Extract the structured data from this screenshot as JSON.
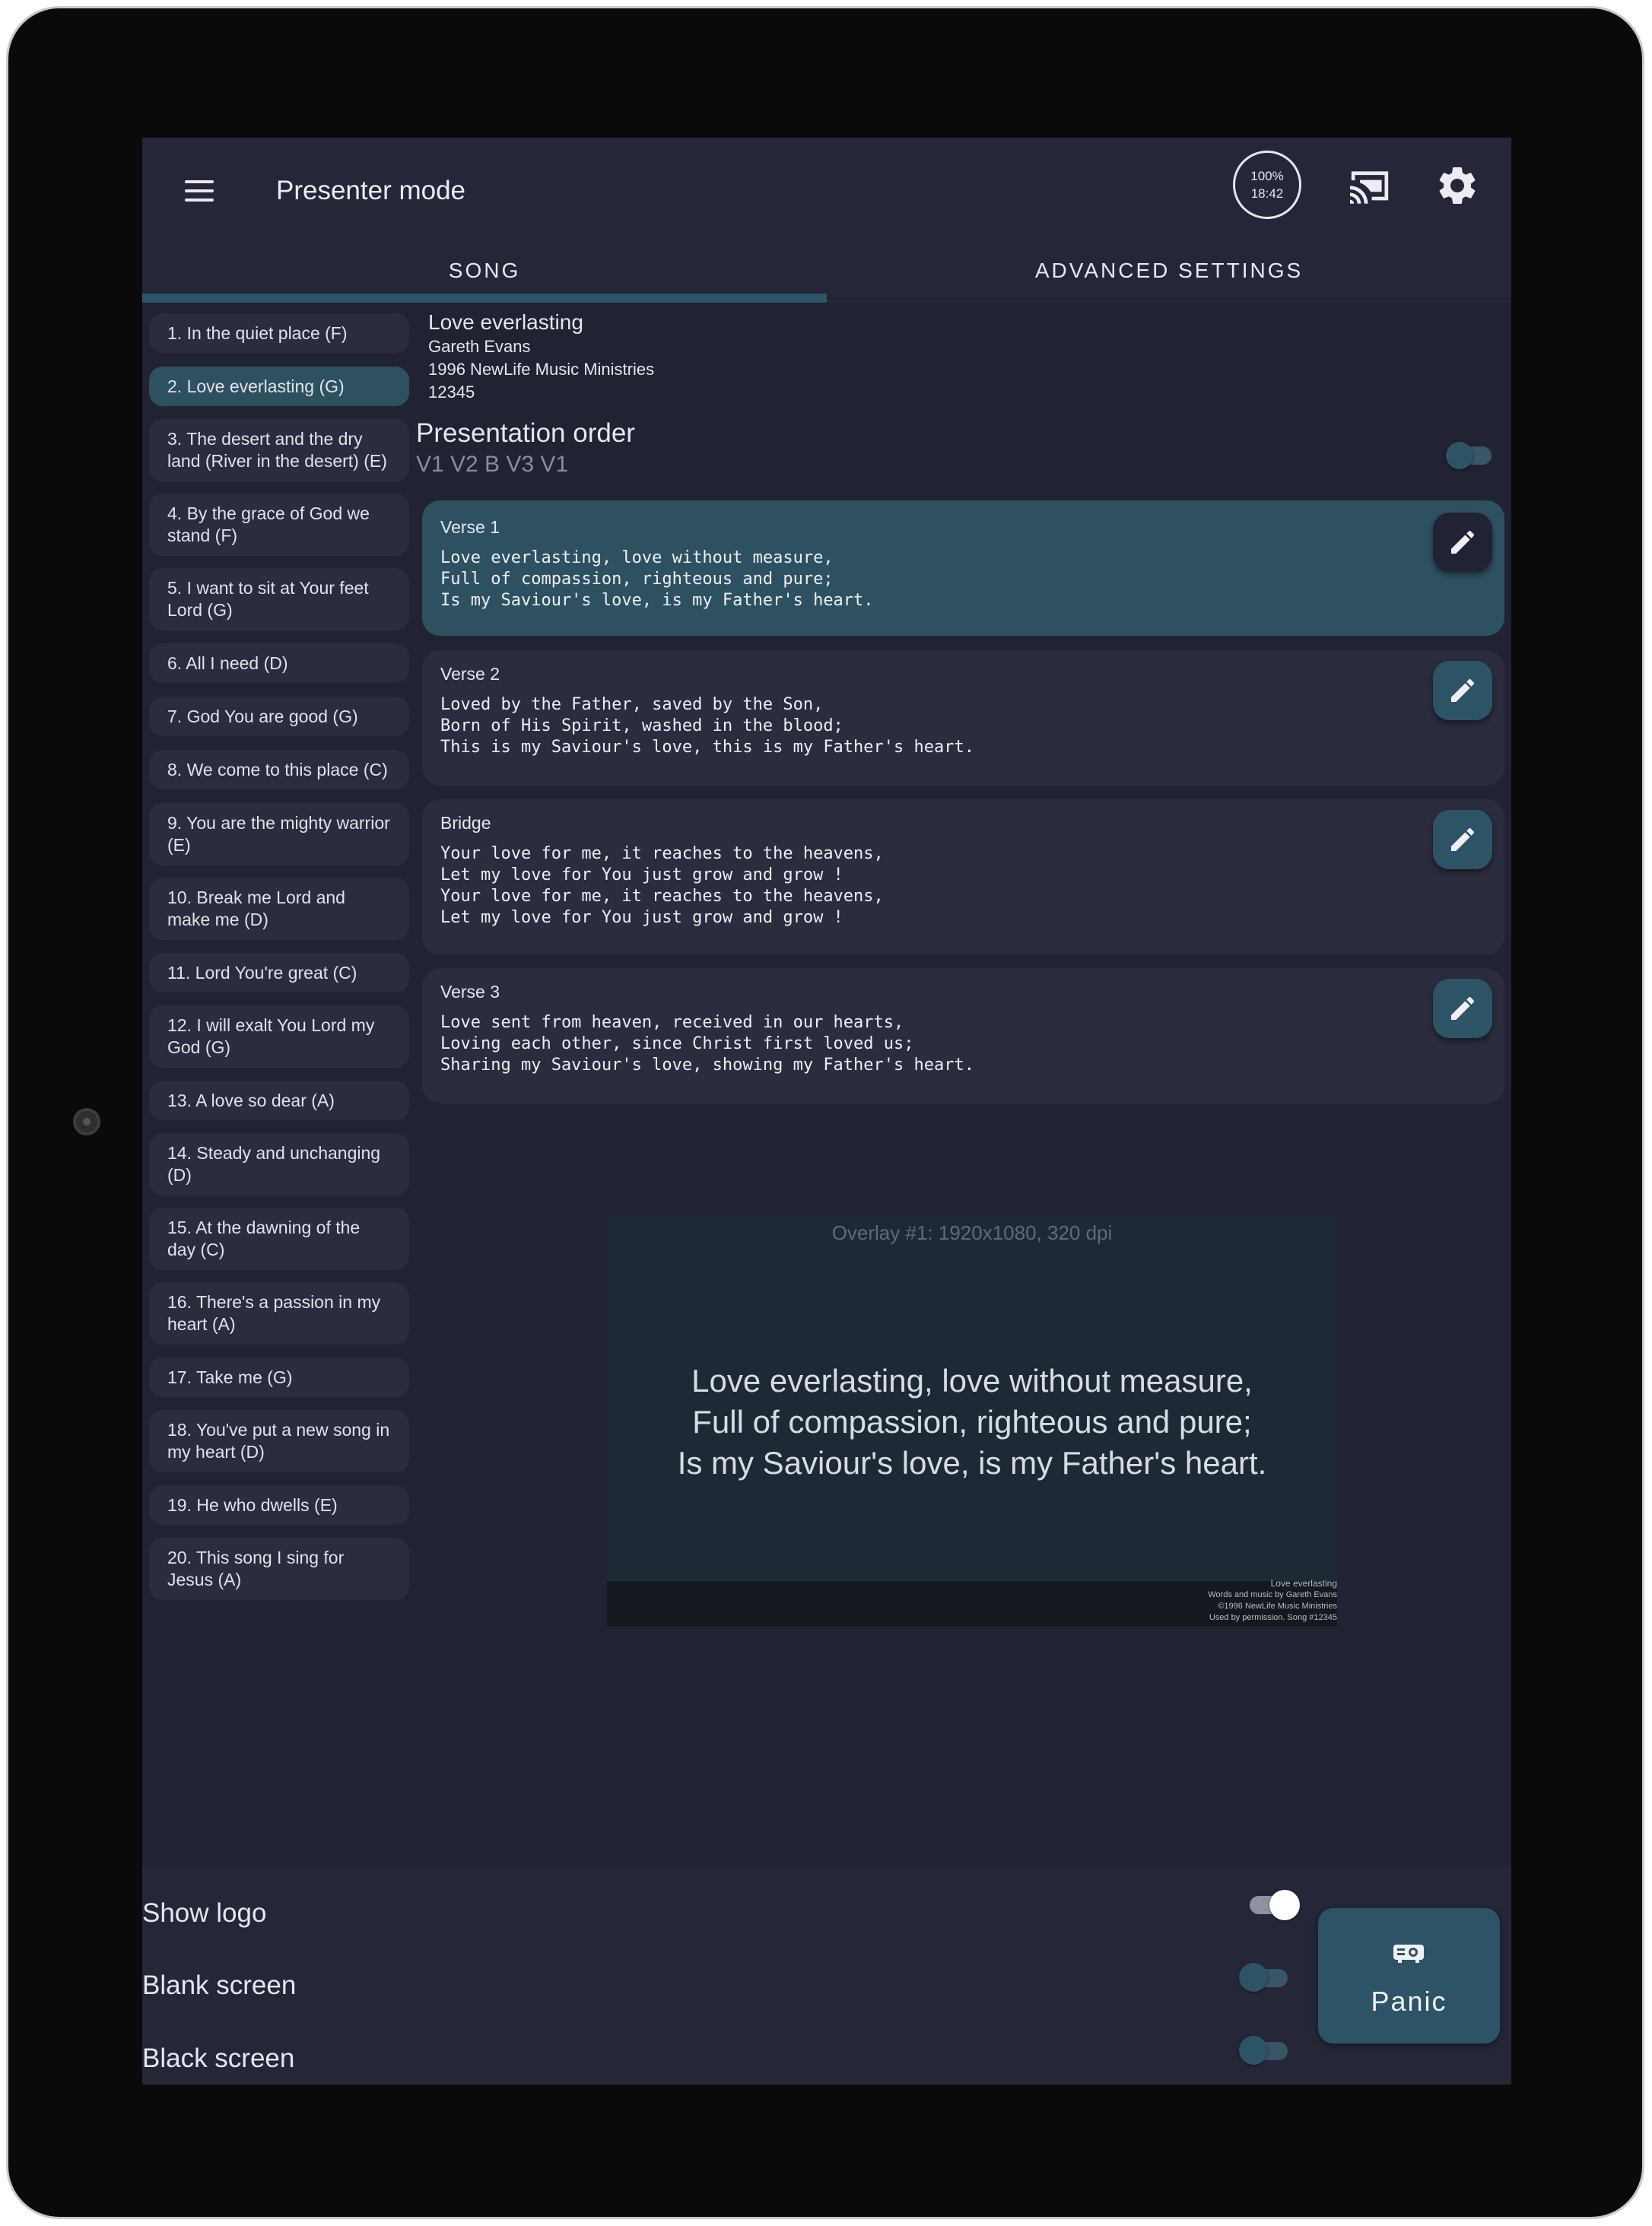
{
  "app": {
    "title": "Presenter mode",
    "battery_percent": "100%",
    "clock": "18:42"
  },
  "tabs": [
    {
      "label": "SONG",
      "selected": true
    },
    {
      "label": "ADVANCED SETTINGS",
      "selected": false
    }
  ],
  "songs": [
    {
      "label": "1. In the quiet place (F)"
    },
    {
      "label": "2. Love everlasting (G)",
      "selected": true
    },
    {
      "label": "3. The desert and the dry land (River in the desert) (E)"
    },
    {
      "label": "4. By the grace of God we stand (F)"
    },
    {
      "label": "5. I want to sit at Your feet Lord (G)"
    },
    {
      "label": "6. All I need (D)"
    },
    {
      "label": "7. God You are good (G)"
    },
    {
      "label": "8. We come to this place (C)"
    },
    {
      "label": "9. You are the mighty warrior (E)"
    },
    {
      "label": "10. Break me Lord and make me (D)"
    },
    {
      "label": "11. Lord You're great (C)"
    },
    {
      "label": "12. I will exalt You Lord my God (G)"
    },
    {
      "label": "13. A love so dear (A)"
    },
    {
      "label": "14. Steady and unchanging (D)"
    },
    {
      "label": "15. At the dawning of the day (C)"
    },
    {
      "label": "16. There's a passion in my heart (A)"
    },
    {
      "label": "17. Take me (G)"
    },
    {
      "label": "18. You've put a new song in my heart (D)"
    },
    {
      "label": "19. He who dwells (E)"
    },
    {
      "label": "20. This song I sing for Jesus (A)"
    }
  ],
  "song": {
    "title": "Love everlasting",
    "author": "Gareth Evans",
    "copyright": "1996 NewLife Music Ministries",
    "ccli": "12345"
  },
  "presentation_order": {
    "label": "Presentation order",
    "value": "V1 V2 B V3 V1",
    "toggle_on": false
  },
  "verses": [
    {
      "label": "Verse 1",
      "text": "Love everlasting, love without measure,\nFull of compassion, righteous and pure;\nIs my Saviour's love, is my Father's heart.",
      "active": true
    },
    {
      "label": "Verse 2",
      "text": "Loved by the Father, saved by the Son,\nBorn of His Spirit, washed in the blood;\nThis is my Saviour's love, this is my Father's heart."
    },
    {
      "label": "Bridge",
      "text": "Your love for me, it reaches to the heavens,\nLet my love for You just grow and grow !\nYour love for me, it reaches to the heavens,\nLet my love for You just grow and grow !"
    },
    {
      "label": "Verse 3",
      "text": "Love sent from heaven, received in our hearts,\nLoving each other, since Christ first loved us;\nSharing my Saviour's love, showing my Father's heart."
    }
  ],
  "overlay": {
    "caption": "Overlay #1: 1920x1080, 320 dpi",
    "lyrics": [
      "Love everlasting, love without measure,",
      "Full of compassion, righteous and pure;",
      "Is my Saviour's love, is my Father's heart."
    ],
    "credits": [
      "Love everlasting",
      "Words and music by Gareth Evans",
      "©1996 NewLife Music Ministries",
      "Used by permission.  Song #12345"
    ]
  },
  "options": [
    {
      "label": "Show logo",
      "on": true
    },
    {
      "label": "Blank screen",
      "on": false
    },
    {
      "label": "Black screen",
      "on": false
    }
  ],
  "panic": {
    "label": "Panic"
  },
  "colors": {
    "background": "#212232",
    "surface": "#252739",
    "card": "#2b2c3d",
    "accent": "#2e5162",
    "text": "#e6e6ee"
  }
}
